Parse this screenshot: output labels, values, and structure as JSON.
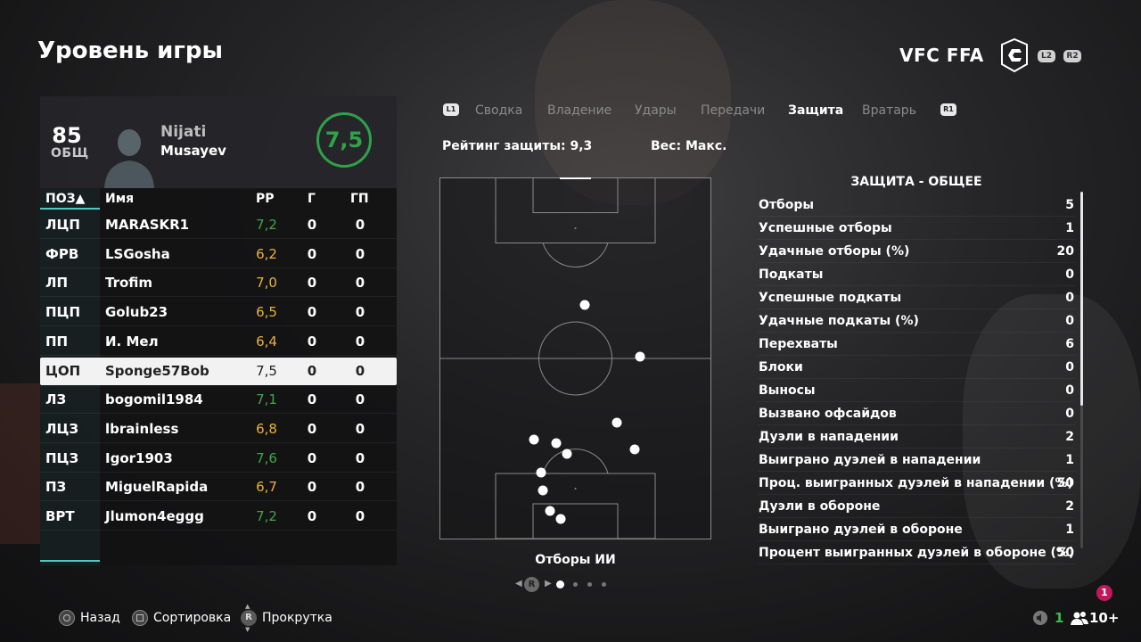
{
  "header": {
    "title": "Уровень игры",
    "brand": "VFC FFA",
    "l2": "L2",
    "r2": "R2"
  },
  "player": {
    "overall": "85",
    "overall_label": "ОБЩ",
    "first_name": "Nijati",
    "last_name": "Musayev",
    "match_rating": "7,5"
  },
  "table": {
    "headers": {
      "pos": "ПОЗ▲",
      "name": "Имя",
      "rating": "РР",
      "goals": "Г",
      "assists": "ГП"
    },
    "rows": [
      {
        "pos": "ЛЦП",
        "name": "MARASKR1",
        "rating": "7,2",
        "goals": "0",
        "assists": "0",
        "color": "#3fa64a"
      },
      {
        "pos": "ФРВ",
        "name": "LSGosha",
        "rating": "6,2",
        "goals": "0",
        "assists": "0",
        "color": "#e8b23a"
      },
      {
        "pos": "ЛП",
        "name": "Trofim",
        "rating": "7,0",
        "goals": "0",
        "assists": "0",
        "color": "#e8b23a"
      },
      {
        "pos": "ПЦП",
        "name": "Golub23",
        "rating": "6,5",
        "goals": "0",
        "assists": "0",
        "color": "#e8b23a"
      },
      {
        "pos": "ПП",
        "name": "И. Мел",
        "rating": "6,4",
        "goals": "0",
        "assists": "0",
        "color": "#e8b23a"
      },
      {
        "pos": "ЦОП",
        "name": "Sponge57Bob",
        "rating": "7,5",
        "goals": "0",
        "assists": "0",
        "color": "#222222"
      },
      {
        "pos": "ЛЗ",
        "name": "bogomil1984",
        "rating": "7,1",
        "goals": "0",
        "assists": "0",
        "color": "#3fa64a"
      },
      {
        "pos": "ЛЦЗ",
        "name": "lbrainless",
        "rating": "6,8",
        "goals": "0",
        "assists": "0",
        "color": "#e8b23a"
      },
      {
        "pos": "ПЦЗ",
        "name": "Igor1903",
        "rating": "7,6",
        "goals": "0",
        "assists": "0",
        "color": "#3fa64a"
      },
      {
        "pos": "ПЗ",
        "name": "MiguelRapida",
        "rating": "6,7",
        "goals": "0",
        "assists": "0",
        "color": "#e8b23a"
      },
      {
        "pos": "ВРТ",
        "name": "Jlumon4eggg",
        "rating": "7,2",
        "goals": "0",
        "assists": "0",
        "color": "#3fa64a"
      }
    ]
  },
  "tabs": {
    "l1": "L1",
    "r1": "R1",
    "items": [
      "Сводка",
      "Владение",
      "Удары",
      "Передачи",
      "Защита",
      "Вратарь"
    ],
    "active": "Защита"
  },
  "defense": {
    "rating_text": "Рейтинг защиты: 9,3",
    "weight_text": "Вес: Макс.",
    "pitch_caption": "Отборы ИИ"
  },
  "stats": {
    "title": "ЗАЩИТА - ОБЩЕЕ",
    "rows": [
      {
        "label": "Отборы",
        "value": "5"
      },
      {
        "label": "Успешные отборы",
        "value": "1"
      },
      {
        "label": "Удачные отборы (%)",
        "value": "20"
      },
      {
        "label": "Подкаты",
        "value": "0"
      },
      {
        "label": "Успешные подкаты",
        "value": "0"
      },
      {
        "label": "Удачные подкаты (%)",
        "value": "0"
      },
      {
        "label": "Перехваты",
        "value": "6"
      },
      {
        "label": "Блоки",
        "value": "0"
      },
      {
        "label": "Выносы",
        "value": "0"
      },
      {
        "label": "Вызвано офсайдов",
        "value": "0"
      },
      {
        "label": "Дуэли в нападении",
        "value": "2"
      },
      {
        "label": "Выиграно дуэлей в нападении",
        "value": "1"
      },
      {
        "label": "Проц. выигранных дуэлей в нападении (%)",
        "value": "50"
      },
      {
        "label": "Дуэли в обороне",
        "value": "2"
      },
      {
        "label": "Выиграно дуэлей в обороне",
        "value": "1"
      },
      {
        "label": "Процент выигранных дуэлей в обороне (%)",
        "value": "50"
      }
    ]
  },
  "pager": {
    "button": "R"
  },
  "footer": {
    "back": "Назад",
    "sort": "Сортировка",
    "scroll": "Прокрутка",
    "scroll_button": "R",
    "notifications": "1",
    "online": "1",
    "party": "10+"
  },
  "colors": {
    "accent": "#4fc9c2",
    "green": "#3fa64a",
    "yellow": "#e8b23a",
    "notif": "#c2185b"
  },
  "icons": [
    "circle-button-icon",
    "square-button-icon",
    "right-stick-icon",
    "speaker-icon",
    "people-icon",
    "brand-logo-icon"
  ]
}
